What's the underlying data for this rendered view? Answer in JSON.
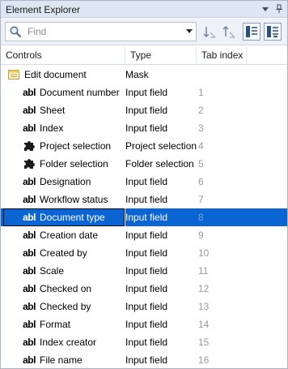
{
  "window": {
    "title": "Element Explorer"
  },
  "toolbar": {
    "search_placeholder": "Find"
  },
  "columns": {
    "controls": "Controls",
    "type": "Type",
    "tab_index": "Tab index"
  },
  "rows": [
    {
      "name": "Edit document",
      "type": "Mask",
      "tab": "",
      "icon": "document-icon",
      "level": 0
    },
    {
      "name": "Document number",
      "type": "Input field",
      "tab": "1",
      "icon": "text-field-icon",
      "level": 1
    },
    {
      "name": "Sheet",
      "type": "Input field",
      "tab": "2",
      "icon": "text-field-icon",
      "level": 1
    },
    {
      "name": "Index",
      "type": "Input field",
      "tab": "3",
      "icon": "text-field-icon",
      "level": 1
    },
    {
      "name": "Project selection",
      "type": "Project selection",
      "tab": "4",
      "icon": "puzzle-icon",
      "level": 1
    },
    {
      "name": "Folder selection",
      "type": "Folder selection",
      "tab": "5",
      "icon": "puzzle-icon",
      "level": 1
    },
    {
      "name": "Designation",
      "type": "Input field",
      "tab": "6",
      "icon": "text-field-icon",
      "level": 1
    },
    {
      "name": "Workflow status",
      "type": "Input field",
      "tab": "7",
      "icon": "text-field-icon",
      "level": 1
    },
    {
      "name": "Document type",
      "type": "Input field",
      "tab": "8",
      "icon": "text-field-icon",
      "level": 1,
      "selected": true
    },
    {
      "name": "Creation date",
      "type": "Input field",
      "tab": "9",
      "icon": "text-field-icon",
      "level": 1
    },
    {
      "name": "Created by",
      "type": "Input field",
      "tab": "10",
      "icon": "text-field-icon",
      "level": 1
    },
    {
      "name": "Scale",
      "type": "Input field",
      "tab": "11",
      "icon": "text-field-icon",
      "level": 1
    },
    {
      "name": "Checked on",
      "type": "Input field",
      "tab": "12",
      "icon": "text-field-icon",
      "level": 1
    },
    {
      "name": "Checked by",
      "type": "Input field",
      "tab": "13",
      "icon": "text-field-icon",
      "level": 1
    },
    {
      "name": "Format",
      "type": "Input field",
      "tab": "14",
      "icon": "text-field-icon",
      "level": 1
    },
    {
      "name": "Index creator",
      "type": "Input field",
      "tab": "15",
      "icon": "text-field-icon",
      "level": 1
    },
    {
      "name": "File name",
      "type": "Input field",
      "tab": "16",
      "icon": "text-field-icon",
      "level": 1
    }
  ],
  "icon_text": {
    "text_field": "abl"
  },
  "colors": {
    "selection": "#0a64d2",
    "titlebar": "#dde6f2",
    "tab_index_text": "#9a9a9a"
  }
}
